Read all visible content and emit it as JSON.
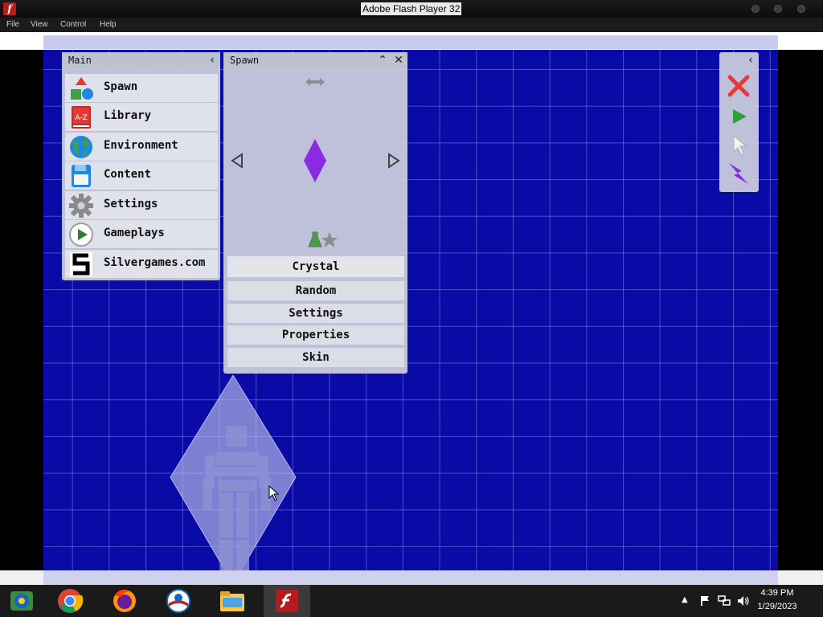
{
  "window": {
    "title": "Adobe Flash Player 32"
  },
  "menubar": {
    "file": "File",
    "view": "View",
    "control": "Control",
    "help": "Help"
  },
  "main_panel": {
    "title": "Main",
    "items": [
      {
        "label": "Spawn",
        "icon": "shapes-icon"
      },
      {
        "label": "Library",
        "icon": "book-az-icon"
      },
      {
        "label": "Environment",
        "icon": "globe-icon"
      },
      {
        "label": "Content",
        "icon": "floppy-disk-icon"
      },
      {
        "label": "Settings",
        "icon": "gear-icon"
      },
      {
        "label": "Gameplays",
        "icon": "play-circle-icon"
      },
      {
        "label": "Silvergames.com",
        "icon": "silvergames-logo-icon"
      }
    ]
  },
  "spawn_panel": {
    "title": "Spawn",
    "selected_object": "Crystal",
    "options": [
      "Random",
      "Settings",
      "Properties",
      "Skin"
    ]
  },
  "taskbar": {
    "time": "4:39 PM",
    "date": "1/29/2023"
  },
  "colors": {
    "stage": "#0a0aa6",
    "crystal": "#8a2be2",
    "panel": "#cdd0de"
  }
}
